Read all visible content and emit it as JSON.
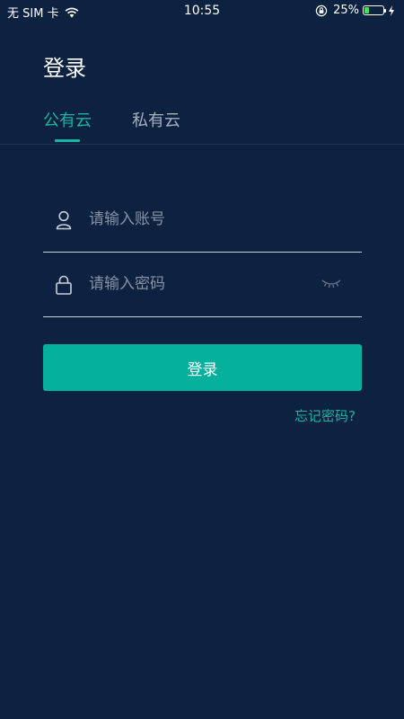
{
  "status_bar": {
    "carrier": "无 SIM 卡",
    "time": "10:55",
    "battery_percent": "25%",
    "battery_level": 0.25,
    "battery_color": "#4cd964"
  },
  "header": {
    "title": "登录"
  },
  "tabs": [
    {
      "label": "公有云",
      "active": true
    },
    {
      "label": "私有云",
      "active": false
    }
  ],
  "form": {
    "account": {
      "placeholder": "请输入账号",
      "value": "",
      "icon": "user-icon"
    },
    "password": {
      "placeholder": "请输入密码",
      "value": "",
      "icon": "lock-icon",
      "toggle_icon": "eye-closed-icon"
    },
    "login_label": "登录",
    "forgot_label": "忘记密码?"
  },
  "colors": {
    "background": "#0d2241",
    "accent": "#1ab4a0",
    "button": "#05b19c"
  }
}
